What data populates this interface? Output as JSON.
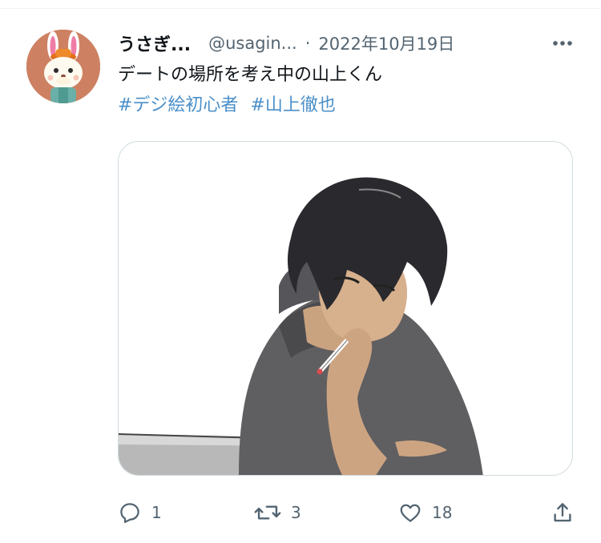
{
  "tweet": {
    "display_name": "うさぎ...",
    "handle": "@usagin...",
    "separator": "·",
    "date": "2022年10月19日",
    "text": "デートの場所を考え中の山上くん",
    "hashtags": [
      "#デジ絵初心者",
      "#山上徹也"
    ],
    "media_icon": "illustration",
    "avatar_icon": "rabbit-avatar-icon"
  },
  "actions": {
    "reply_count": "1",
    "retweet_count": "3",
    "like_count": "18"
  },
  "colors": {
    "link": "#4a8fc9",
    "secondary_text": "#536471",
    "primary_text": "#0f1419",
    "border": "#cfd9de"
  }
}
